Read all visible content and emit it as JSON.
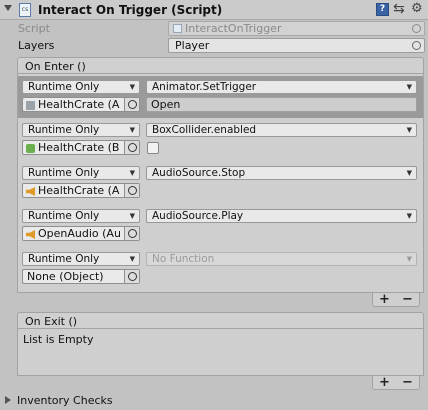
{
  "component": {
    "title": "Interact On Trigger (Script)",
    "script_label": "Script",
    "script_value": "InteractOnTrigger",
    "layers_label": "Layers",
    "layers_value": "Player"
  },
  "on_enter": {
    "header": "On Enter ()",
    "entries": [
      {
        "mode": "Runtime Only",
        "function": "Animator.SetTrigger",
        "target": "HealthCrate (A",
        "argument": "Open",
        "target_icon": "gameobject-icon"
      },
      {
        "mode": "Runtime Only",
        "function": "BoxCollider.enabled",
        "target": "HealthCrate (B",
        "argument_checkbox": false,
        "target_icon": "boxcollider-icon"
      },
      {
        "mode": "Runtime Only",
        "function": "AudioSource.Stop",
        "target": "HealthCrate (A",
        "target_icon": "audiosource-icon"
      },
      {
        "mode": "Runtime Only",
        "function": "AudioSource.Play",
        "target": "OpenAudio (Au",
        "target_icon": "audiosource-icon"
      },
      {
        "mode": "Runtime Only",
        "function": "No Function",
        "target": "None (Object)"
      }
    ],
    "add_label": "+",
    "remove_label": "−"
  },
  "on_exit": {
    "header": "On Exit ()",
    "empty_text": "List is Empty",
    "add_label": "+",
    "remove_label": "−"
  },
  "inventory_checks": {
    "label": "Inventory Checks"
  },
  "icons": {
    "help": "?",
    "settings": "⇆",
    "gear": "⚙",
    "dropdown_arrow": "▼"
  }
}
